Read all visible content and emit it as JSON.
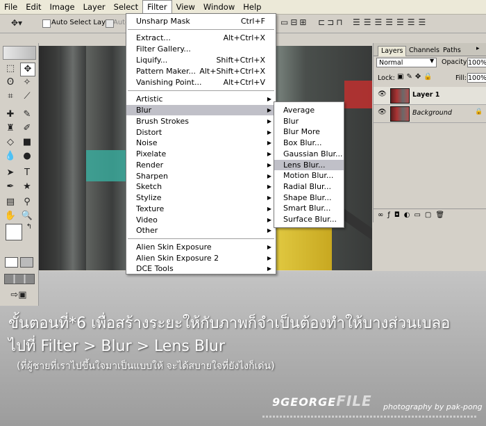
{
  "menubar": {
    "items": [
      "File",
      "Edit",
      "Image",
      "Layer",
      "Select",
      "Filter",
      "View",
      "Window",
      "Help"
    ],
    "active": "Filter"
  },
  "options": {
    "auto_select_layer": "Auto Select Layer",
    "auto_partial": "Auto"
  },
  "filter_menu": {
    "last_filter": {
      "label": "Unsharp Mask",
      "shortcut": "Ctrl+F"
    },
    "special": [
      {
        "label": "Extract...",
        "shortcut": "Alt+Ctrl+X"
      },
      {
        "label": "Filter Gallery...",
        "shortcut": ""
      },
      {
        "label": "Liquify...",
        "shortcut": "Shift+Ctrl+X"
      },
      {
        "label": "Pattern Maker...",
        "shortcut": "Alt+Shift+Ctrl+X"
      },
      {
        "label": "Vanishing Point...",
        "shortcut": "Alt+Ctrl+V"
      }
    ],
    "categories": [
      "Artistic",
      "Blur",
      "Brush Strokes",
      "Distort",
      "Noise",
      "Pixelate",
      "Render",
      "Sharpen",
      "Sketch",
      "Stylize",
      "Texture",
      "Video",
      "Other"
    ],
    "plugins": [
      "Alien Skin Exposure",
      "Alien Skin Exposure 2",
      "DCE Tools"
    ],
    "highlighted": "Blur"
  },
  "blur_submenu": {
    "items": [
      "Average",
      "Blur",
      "Blur More",
      "Box Blur...",
      "Gaussian Blur...",
      "Lens Blur...",
      "Motion Blur...",
      "Radial Blur...",
      "Shape Blur...",
      "Smart Blur...",
      "Surface Blur..."
    ],
    "highlighted": "Lens Blur..."
  },
  "layers_panel": {
    "tabs": [
      "Layers",
      "Channels",
      "Paths"
    ],
    "blend_mode": "Normal",
    "opacity_label": "Opacity:",
    "opacity_value": "100%",
    "lock_label": "Lock:",
    "fill_label": "Fill:",
    "fill_value": "100%",
    "layers": [
      {
        "name": "Layer 1",
        "selected": true
      },
      {
        "name": "Background",
        "selected": false
      }
    ]
  },
  "caption": {
    "line1": "ขั้นตอนที่*6 เพื่อสร้างระยะให้กับภาพก็จำเป็นต้องทำให้บางส่วนเบลอ",
    "line2": "ไปที่ Filter > Blur > Lens Blur",
    "line3": "(ที่ผู้ชายที่เราไปขึ้นใจมาเป็นแบบให้ จะได้สบายใจที่ยังไงก็เด่น)"
  },
  "watermark": {
    "brand": "9GEORGE",
    "brand_suffix": "FILE",
    "credit": "photography by pak-pong"
  },
  "colors": {
    "menu_highlight": "#c0c0c8",
    "menubar_bg": "#ece9d8",
    "panel_bg": "#d4d0c8",
    "page_bg": "#a8a8a8"
  }
}
